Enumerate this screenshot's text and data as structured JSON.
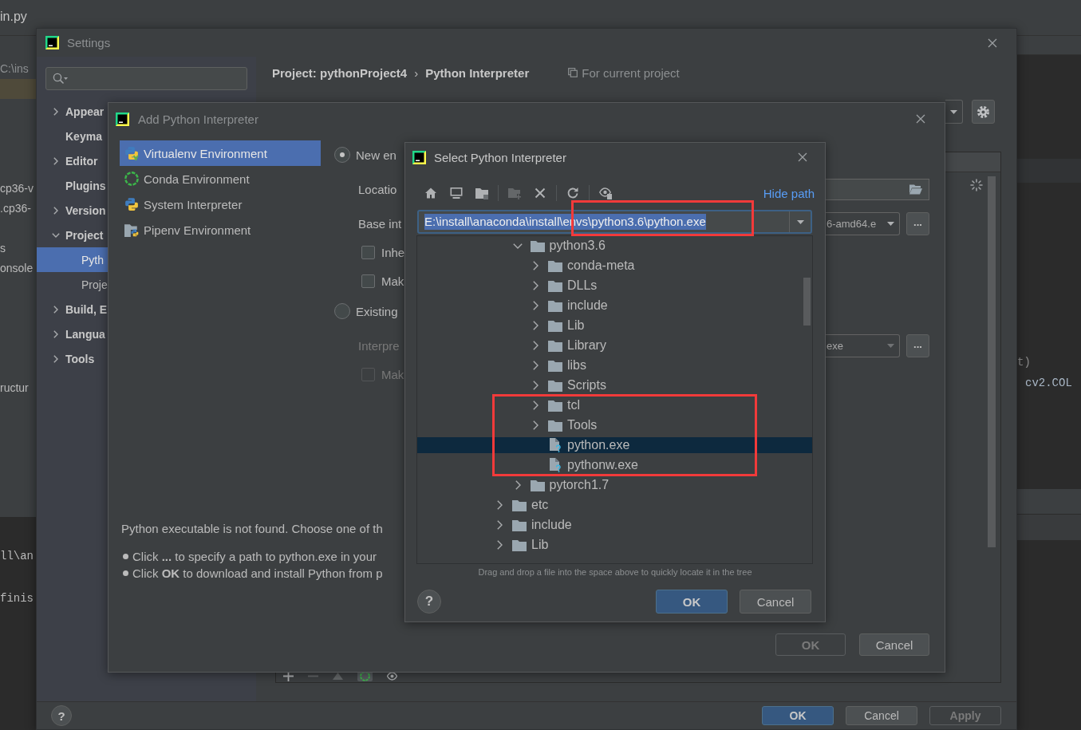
{
  "ide": {
    "tab": "in.py",
    "project_rows": [
      {
        "text": "C:\\ins",
        "selected": false
      },
      {
        "selected": true
      },
      {
        "text": "cp36-v",
        "selected": false
      },
      {
        "text": ".cp36-",
        "selected": false
      },
      {
        "text": "s",
        "selected": false
      },
      {
        "text": "onsole",
        "selected": false
      },
      {
        "text": "ructur",
        "selected": false
      }
    ],
    "console_lines": [
      "ll\\an",
      "finis"
    ],
    "editor_lines": [
      "t)",
      "cv2.COL"
    ]
  },
  "settings": {
    "title": "Settings",
    "tree": [
      {
        "label": "Appear",
        "expanded": false,
        "selected": false
      },
      {
        "label": "Keyma",
        "selected": false
      },
      {
        "label": "Editor",
        "expanded": false,
        "selected": false
      },
      {
        "label": "Plugins",
        "selected": false
      },
      {
        "label": "Version",
        "expanded": false,
        "selected": false
      },
      {
        "label": "Project",
        "expanded": true,
        "selected": false,
        "children": [
          {
            "label": "Pyth",
            "selected": true
          },
          {
            "label": "Proje",
            "selected": false
          }
        ]
      },
      {
        "label": "Build, E",
        "expanded": false,
        "selected": false
      },
      {
        "label": "Langua",
        "expanded": false,
        "selected": false
      },
      {
        "label": "Tools",
        "expanded": false,
        "selected": false
      }
    ],
    "breadcrumb": [
      "Project: pythonProject4",
      "Python Interpreter"
    ],
    "breadcrumb_separator": "›",
    "scope_note": "For current project",
    "table_toolbar": [
      {
        "disabled": false,
        "selected": false
      },
      {
        "disabled": true,
        "selected": false
      },
      {
        "disabled": true,
        "selected": false
      },
      {
        "disabled": false,
        "selected": true
      },
      {
        "disabled": false,
        "selected": false
      }
    ],
    "help": "?",
    "buttons": [
      {
        "label": "OK",
        "primary": true,
        "disabled": false
      },
      {
        "label": "Cancel",
        "primary": false,
        "disabled": false
      },
      {
        "label": "Apply",
        "primary": false,
        "disabled": true
      }
    ]
  },
  "add_dialog": {
    "title": "Add Python Interpreter",
    "env_types": [
      {
        "kind": "virtualenv",
        "label": "Virtualenv Environment",
        "selected": true
      },
      {
        "kind": "conda",
        "label": "Conda Environment",
        "selected": false
      },
      {
        "kind": "system",
        "label": "System Interpreter",
        "selected": false
      },
      {
        "kind": "pipenv",
        "label": "Pipenv Environment",
        "selected": false
      }
    ],
    "options": [
      {
        "kind": "radio",
        "label": "New en",
        "selected": true,
        "disabled": false
      },
      {
        "kind": "field",
        "label": "Locatio",
        "disabled": false
      },
      {
        "kind": "dropdown",
        "label": "Base int",
        "value": "6-amd64.e",
        "browse": "...",
        "disabled": false
      },
      {
        "kind": "checkbox",
        "label": "Inhe",
        "checked": false,
        "disabled": false
      },
      {
        "kind": "checkbox",
        "label": "Mak",
        "checked": false,
        "disabled": false
      },
      {
        "kind": "radio",
        "label": "Existing",
        "selected": false,
        "disabled": false
      },
      {
        "kind": "dropdown",
        "label": "Interpre",
        "value": "exe",
        "browse": "...",
        "disabled": true
      },
      {
        "kind": "checkbox",
        "label": "Mak",
        "checked": false,
        "disabled": true
      }
    ],
    "message": "Python executable is not found. Choose one of th",
    "hints": [
      "Click **...** to specify a path to python.exe in your",
      "Click **OK** to download and install Python from p"
    ],
    "buttons": [
      {
        "label": "OK",
        "primary": false,
        "disabled": true
      },
      {
        "label": "Cancel",
        "primary": false,
        "disabled": false
      }
    ]
  },
  "select_dialog": {
    "title": "Select Python Interpreter",
    "toolbar": [
      {
        "disabled": false
      },
      {
        "disabled": false
      },
      {
        "disabled": false
      },
      {
        "disabled": true
      },
      {
        "disabled": false
      },
      {
        "disabled": false
      },
      {
        "disabled": false
      }
    ],
    "hide_path_link": "Hide path",
    "path": {
      "value": "E:\\install\\anaconda\\install\\envs\\python3.6\\python.exe",
      "selected": true
    },
    "tree": [
      {
        "children": [
          {
            "label": "python3.6",
            "kind": "folder",
            "expanded": true,
            "selected": false,
            "children": [
              {
                "label": "conda-meta",
                "kind": "folder",
                "expanded": false,
                "selected": false
              },
              {
                "label": "DLLs",
                "kind": "folder",
                "expanded": false,
                "selected": false
              },
              {
                "label": "include",
                "kind": "folder",
                "expanded": false,
                "selected": false
              },
              {
                "label": "Lib",
                "kind": "folder",
                "expanded": false,
                "selected": false
              },
              {
                "label": "Library",
                "kind": "folder",
                "expanded": false,
                "selected": false
              },
              {
                "label": "libs",
                "kind": "folder",
                "expanded": false,
                "selected": false
              },
              {
                "label": "Scripts",
                "kind": "folder",
                "expanded": false,
                "selected": false
              },
              {
                "label": "tcl",
                "kind": "folder",
                "expanded": false,
                "selected": false
              },
              {
                "label": "Tools",
                "kind": "folder",
                "expanded": false,
                "selected": false
              },
              {
                "label": "python.exe",
                "kind": "file",
                "selected": true
              },
              {
                "label": "pythonw.exe",
                "kind": "file",
                "selected": false
              }
            ]
          },
          {
            "label": "pytorch1.7",
            "kind": "folder",
            "expanded": false,
            "selected": false
          }
        ]
      },
      {
        "label": "etc",
        "kind": "folder",
        "expanded": false,
        "selected": false
      },
      {
        "label": "include",
        "kind": "folder",
        "expanded": false,
        "selected": false
      },
      {
        "label": "Lib",
        "kind": "folder",
        "expanded": false,
        "selected": false
      }
    ],
    "hint": "Drag and drop a file into the space above to quickly locate it in the tree",
    "help": "?",
    "buttons": [
      {
        "label": "OK",
        "primary": true,
        "disabled": false
      },
      {
        "label": "Cancel",
        "primary": false,
        "disabled": false
      }
    ]
  }
}
